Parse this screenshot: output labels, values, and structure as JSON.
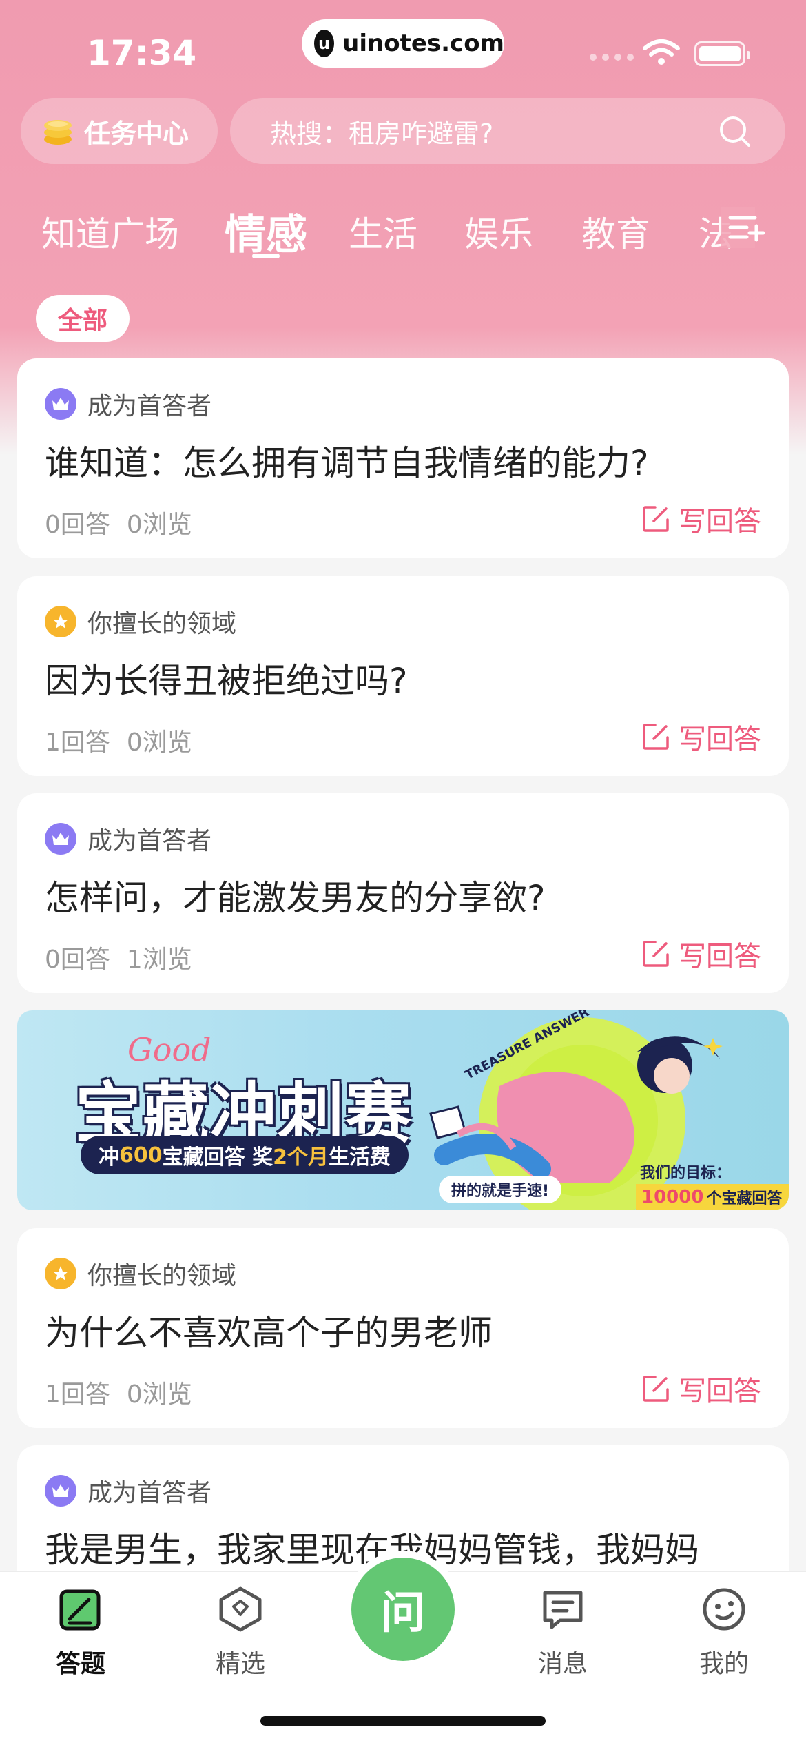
{
  "status_bar": {
    "time": "17:34",
    "url": "uinotes.com",
    "url_logo_letter": "u"
  },
  "top": {
    "task_center_label": "任务中心",
    "search_hot": "热搜：租房咋避雷?"
  },
  "tabs": [
    {
      "label": "知道广场",
      "active": false
    },
    {
      "label": "情感",
      "active": true
    },
    {
      "label": "生活",
      "active": false
    },
    {
      "label": "娱乐",
      "active": false
    },
    {
      "label": "教育",
      "active": false
    },
    {
      "label": "法",
      "active": false
    }
  ],
  "filter": {
    "all_label": "全部"
  },
  "cards": [
    {
      "tag_icon": "crown-icon",
      "tag": "成为首答者",
      "question": "谁知道：怎么拥有调节自我情绪的能力?",
      "answers": "0回答",
      "views": "0浏览",
      "action": "写回答"
    },
    {
      "tag_icon": "star-icon",
      "tag": "你擅长的领域",
      "question": "因为长得丑被拒绝过吗?",
      "answers": "1回答",
      "views": "0浏览",
      "action": "写回答"
    },
    {
      "tag_icon": "crown-icon",
      "tag": "成为首答者",
      "question": "怎样问，才能激发男友的分享欲?",
      "answers": "0回答",
      "views": "1浏览",
      "action": "写回答"
    },
    {
      "tag_icon": "star-icon",
      "tag": "你擅长的领域",
      "question": "为什么不喜欢高个子的男老师",
      "answers": "1回答",
      "views": "0浏览",
      "action": "写回答"
    },
    {
      "tag_icon": "crown-icon",
      "tag": "成为首答者",
      "question": "我是男生，我家里现在我妈妈管钱，我妈妈"
    }
  ],
  "banner": {
    "good": "Good",
    "title": "宝藏冲刺赛",
    "sub_prefix": "冲",
    "sub_num": "600",
    "sub_mid": "宝藏回答 奖",
    "sub_num2": "2个月",
    "sub_suffix": "生活费",
    "treasure": "TREASURE ANSWER",
    "fast": "拼的就是手速!",
    "goal_label": "我们的目标：",
    "goal_num": "10000",
    "goal_suffix": "个宝藏回答"
  },
  "bottom_nav": {
    "answer": "答题",
    "featured": "精选",
    "ask": "问",
    "messages": "消息",
    "mine": "我的"
  },
  "colors": {
    "brand_pink": "#ee5b7d",
    "header_pink": "#f09bb0",
    "ask_green": "#63c773"
  }
}
